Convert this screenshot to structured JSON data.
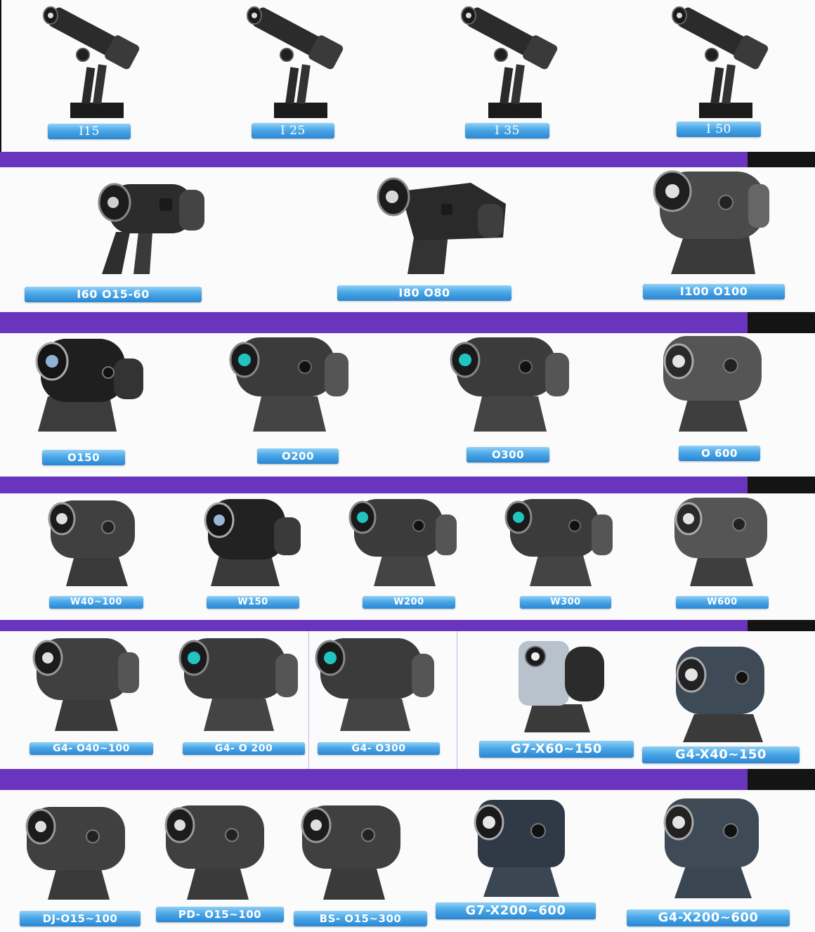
{
  "rows": [
    {
      "products": [
        {
          "label": "I15",
          "icon": "spot-projector"
        },
        {
          "label": "I 25",
          "icon": "spot-projector"
        },
        {
          "label": "I 35",
          "icon": "spot-projector"
        },
        {
          "label": "I 50",
          "icon": "spot-projector"
        }
      ]
    },
    {
      "products": [
        {
          "label": "I60          O15-60",
          "icon": "gobo-projector"
        },
        {
          "label": "I80                O80",
          "icon": "gobo-projector"
        },
        {
          "label": "I100    O100",
          "icon": "gobo-projector"
        }
      ]
    },
    {
      "products": [
        {
          "label": "O150",
          "icon": "gobo-projector"
        },
        {
          "label": "O200",
          "icon": "gobo-projector"
        },
        {
          "label": "O300",
          "icon": "gobo-projector"
        },
        {
          "label": "O 600",
          "icon": "gobo-projector"
        }
      ]
    },
    {
      "products": [
        {
          "label": "W40~100",
          "icon": "gobo-projector"
        },
        {
          "label": "W150",
          "icon": "gobo-projector"
        },
        {
          "label": "W200",
          "icon": "gobo-projector"
        },
        {
          "label": "W300",
          "icon": "gobo-projector"
        },
        {
          "label": "W600",
          "icon": "gobo-projector"
        }
      ]
    },
    {
      "products": [
        {
          "label": "G4-   O40~100",
          "icon": "gobo-projector"
        },
        {
          "label": "G4-   O 200",
          "icon": "gobo-projector"
        },
        {
          "label": "G4-   O300",
          "icon": "gobo-projector"
        },
        {
          "label": "G7-X60~150",
          "icon": "gobo-projector"
        },
        {
          "label": "G4-X40~150",
          "icon": "gobo-projector"
        }
      ]
    },
    {
      "products": [
        {
          "label": "DJ-O15~100",
          "icon": "gobo-projector"
        },
        {
          "label": "PD- O15~100",
          "icon": "gobo-projector"
        },
        {
          "label": "BS-  O15~300",
          "icon": "gobo-projector"
        },
        {
          "label": "G7-X200~600",
          "icon": "gobo-projector"
        },
        {
          "label": "G4-X200~600",
          "icon": "gobo-projector"
        }
      ]
    }
  ],
  "colors": {
    "divider": "#6a35be",
    "divider_end": "#141414",
    "label_top": "#8fd0f7",
    "label_bottom": "#2b86d3",
    "label_text": "#ffffff"
  }
}
